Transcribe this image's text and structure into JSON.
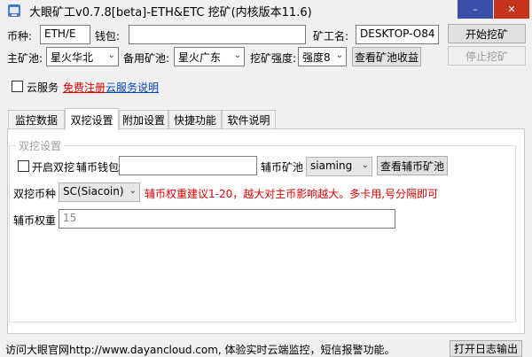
{
  "window": {
    "title": "大眼矿工v0.7.8[beta]-ETH&ETC 挖矿(内核版本11.6)",
    "minimize_glyph": "–",
    "close_glyph": "✕"
  },
  "top_form": {
    "coin_label": "币种:",
    "coin_value": "ETH/E",
    "wallet_label": "钱包:",
    "wallet_value": "",
    "worker_label": "矿工名:",
    "worker_value": "DESKTOP-O84",
    "start_button": "开始挖矿",
    "pool_label": "主矿池:",
    "pool_value": "星火华北",
    "backup_pool_label": "备用矿池:",
    "backup_pool_value": "星火广东",
    "intensity_label": "挖矿强度:",
    "intensity_value": "强度8",
    "check_pool_button": "查看矿池收益",
    "stop_button": "停止挖矿"
  },
  "cloud": {
    "checkbox_label": "云服务",
    "register_link": "免费注册",
    "help_link": "云服务说明"
  },
  "tabs": [
    {
      "label": "监控数据"
    },
    {
      "label": "双挖设置"
    },
    {
      "label": "附加设置"
    },
    {
      "label": "快捷功能"
    },
    {
      "label": "软件说明"
    }
  ],
  "dual_mining": {
    "group_title": "双挖设置",
    "enable_label": "开启双挖",
    "sub_wallet_label": "辅币钱包",
    "sub_wallet_value": "",
    "sub_pool_label": "辅币矿池",
    "sub_pool_value": "siaming",
    "check_sub_pool_button": "查看辅币矿池",
    "coin_type_label": "双挖币种",
    "coin_type_value": "SC(Siacoin)",
    "weight_hint": "辅币权重建议1-20，越大对主币影响越大。多卡用,号分隔即可",
    "weight_label": "辅币权重",
    "weight_value": "15"
  },
  "status": {
    "text": "访问大眼官网http://www.dayancloud.com, 体验实时云端监控，短信报警功能。",
    "log_button": "打开日志输出"
  },
  "colors": {
    "minimize_bg": "#3c4fa8",
    "close_bg": "#c6321b",
    "hint_red": "#e00000",
    "link_blue": "#0645c0"
  }
}
